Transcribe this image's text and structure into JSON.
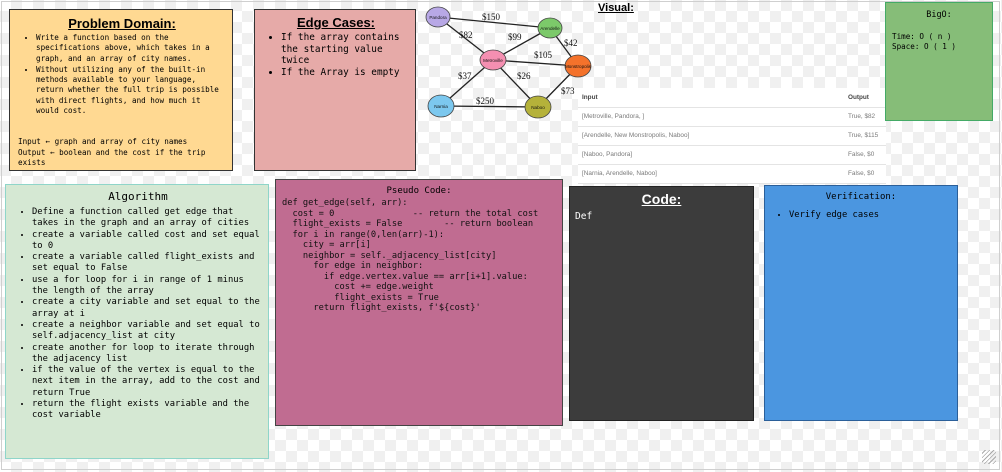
{
  "problem": {
    "title": "Problem Domain:",
    "bullets": [
      "Write a function based on the specifications above, which takes in a graph, and an array of city names.",
      "Without utilizing any of the built-in methods available to your language, return whether the full trip is possible with direct flights, and how much it would cost."
    ],
    "input_line": "Input ← graph and array of city names",
    "output_line": "Output ← boolean and the cost if the trip exists"
  },
  "edge": {
    "title": "Edge Cases:",
    "bullets": [
      "If the array contains the starting value twice",
      "If the Array is empty"
    ]
  },
  "visual": {
    "label": "Visual:",
    "nodes": {
      "pandora": "Pandora",
      "arendelle": "Arendelle",
      "metroville": "Metroville",
      "monstropolis": "Monstropolis",
      "narnia": "Narnia",
      "naboo": "Naboo"
    },
    "weights": {
      "pan_aren": "$150",
      "pan_metro": "$82",
      "metro_aren": "$99",
      "aren_mon": "$42",
      "metro_mon": "$105",
      "narnia_metro": "$37",
      "naboo_metro": "$26",
      "narnia_naboo": "$250",
      "naboo_mon": "$73"
    },
    "colors": {
      "pandora": "#b8a8e6",
      "arendelle": "#7cc96a",
      "metroville": "#f48fb1",
      "monstropolis": "#f4722b",
      "narnia": "#7cc8ef",
      "naboo": "#b5b23a"
    }
  },
  "table": {
    "headers": [
      "Input",
      "Output"
    ],
    "rows": [
      [
        "[Metroville, Pandora, ]",
        "True, $82"
      ],
      [
        "[Arendelle, New Monstropolis, Naboo]",
        "True, $115"
      ],
      [
        "[Naboo, Pandora]",
        "False, $0"
      ],
      [
        "[Narnia, Arendelle, Naboo]",
        "False, $0"
      ]
    ]
  },
  "bigo": {
    "title": "BigO:",
    "time": "Time: O ( n )",
    "space": "Space: O ( 1 )"
  },
  "algorithm": {
    "title": "Algorithm",
    "steps": [
      "Define a function called get edge that takes in the graph and an array of cities",
      "create a variable called cost and set equal to 0",
      "create a variable called flight_exists and set equal to False",
      "use a for loop for i in range of 1 minus the length of the array",
      "create a city variable and set equal to the array at i",
      "create a neighbor variable and set equal to self.adjacency_list at city",
      "create another for loop to iterate through the adjacency list",
      "if the value of the vertex is equal to the next item in the array, add to the cost and return True",
      "return the flight exists variable and the cost variable"
    ]
  },
  "pseudo": {
    "title": "Pseudo Code:",
    "code": "def get_edge(self, arr):\n  cost = 0               -- return the total cost\n  flight_exists = False        -- return boolean\n  for i in range(0,len(arr)-1):\n    city = arr[i]\n    neighbor = self._adjacency_list[city]\n      for edge in neighbor:\n        if edge.vertex.value == arr[i+1].value:\n          cost += edge.weight\n          flight_exists = True\n      return flight_exists, f'${cost}'"
  },
  "code_panel": {
    "title": "Code:",
    "body": "Def"
  },
  "verification": {
    "title": "Verification:",
    "bullets": [
      "Verify edge cases"
    ]
  }
}
